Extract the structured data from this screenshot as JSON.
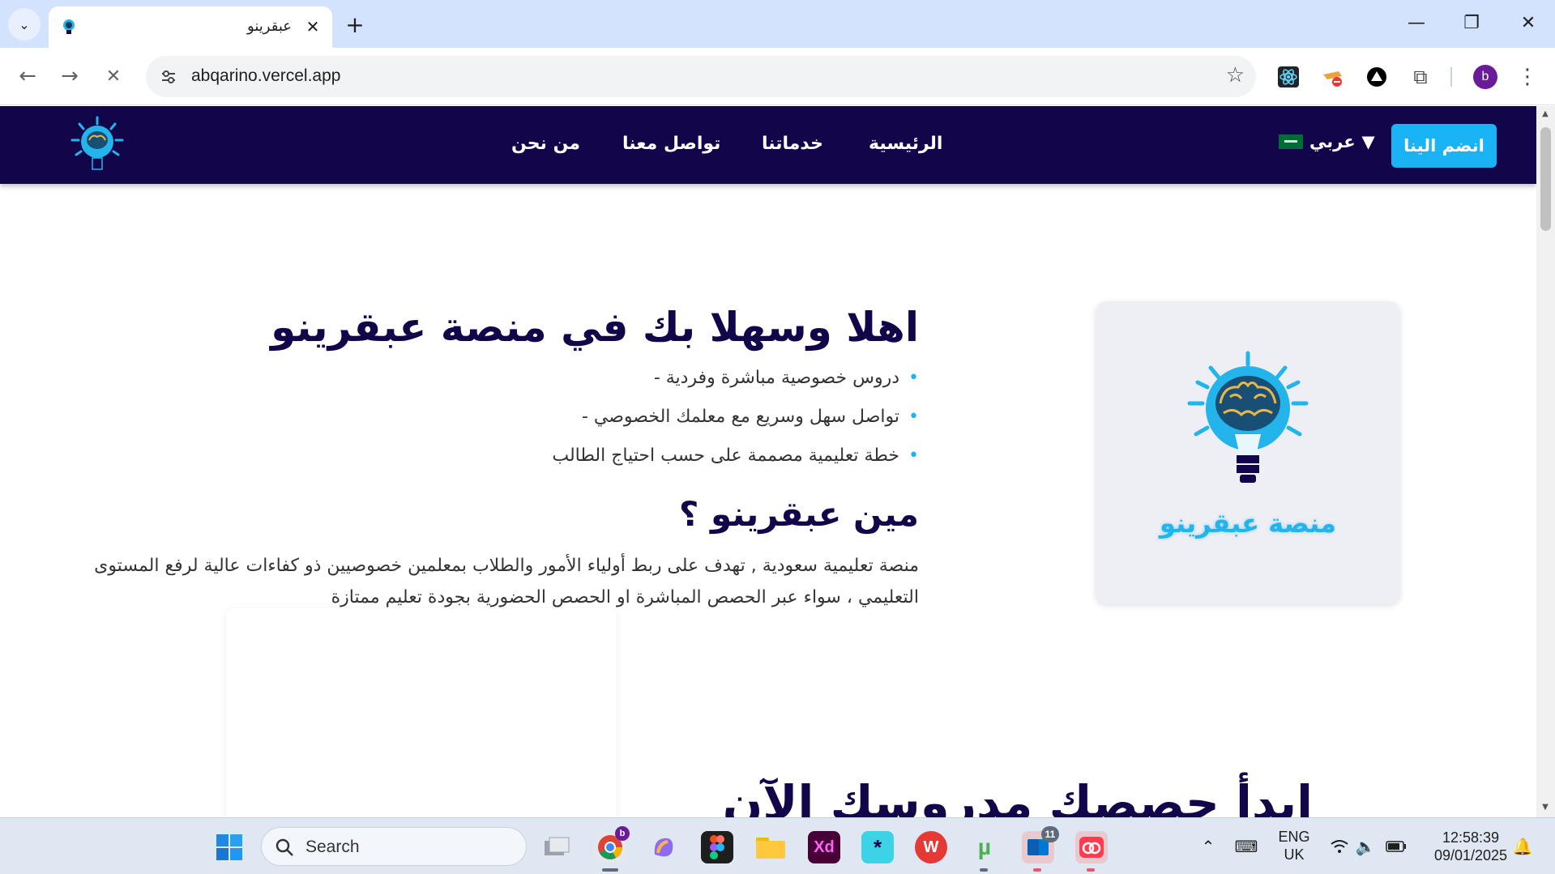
{
  "browser": {
    "tab_title": "عبقرينو",
    "url": "abqarino.vercel.app",
    "profile_initial": "b"
  },
  "site": {
    "nav": {
      "home": "الرئيسية",
      "services": "خدماتنا",
      "contact": "تواصل معنا",
      "about": "من نحن",
      "language": "عربي",
      "language_arrow": "▼",
      "join": "انضم الينا"
    },
    "hero": {
      "brand": "منصة عبقرينو",
      "title": "اهلا وسهلا بك في منصة عبقرينو",
      "bullets": [
        "دروس خصوصية مباشرة وفردية -",
        "تواصل سهل وسريع مع معلمك الخصوصي -",
        "خطة تعليمية مصممة على حسب احتياج الطالب"
      ],
      "who_title": "مين عبقرينو ؟",
      "who_text": "منصة تعليمية سعودية , تهدف على ربط أولياء الأمور والطلاب بمعلمين خصوصيين ذو كفاءات عالية لرفع المستوى التعليمي ، سواء عبر الحصص المباشرة او الحصص الحضورية بجودة تعليم ممتازة"
    },
    "next_section_title": "ابدأ حصصك مدروسك الآن"
  },
  "taskbar": {
    "search_label": "Search",
    "language_line1": "ENG",
    "language_line2": "UK",
    "time": "12:58:39",
    "date": "09/01/2025",
    "notification_count": "11",
    "chrome_badge": "b"
  },
  "colors": {
    "nav_bg": "#12054a",
    "accent": "#1ab3f5",
    "brand_text": "#24b4ec"
  }
}
